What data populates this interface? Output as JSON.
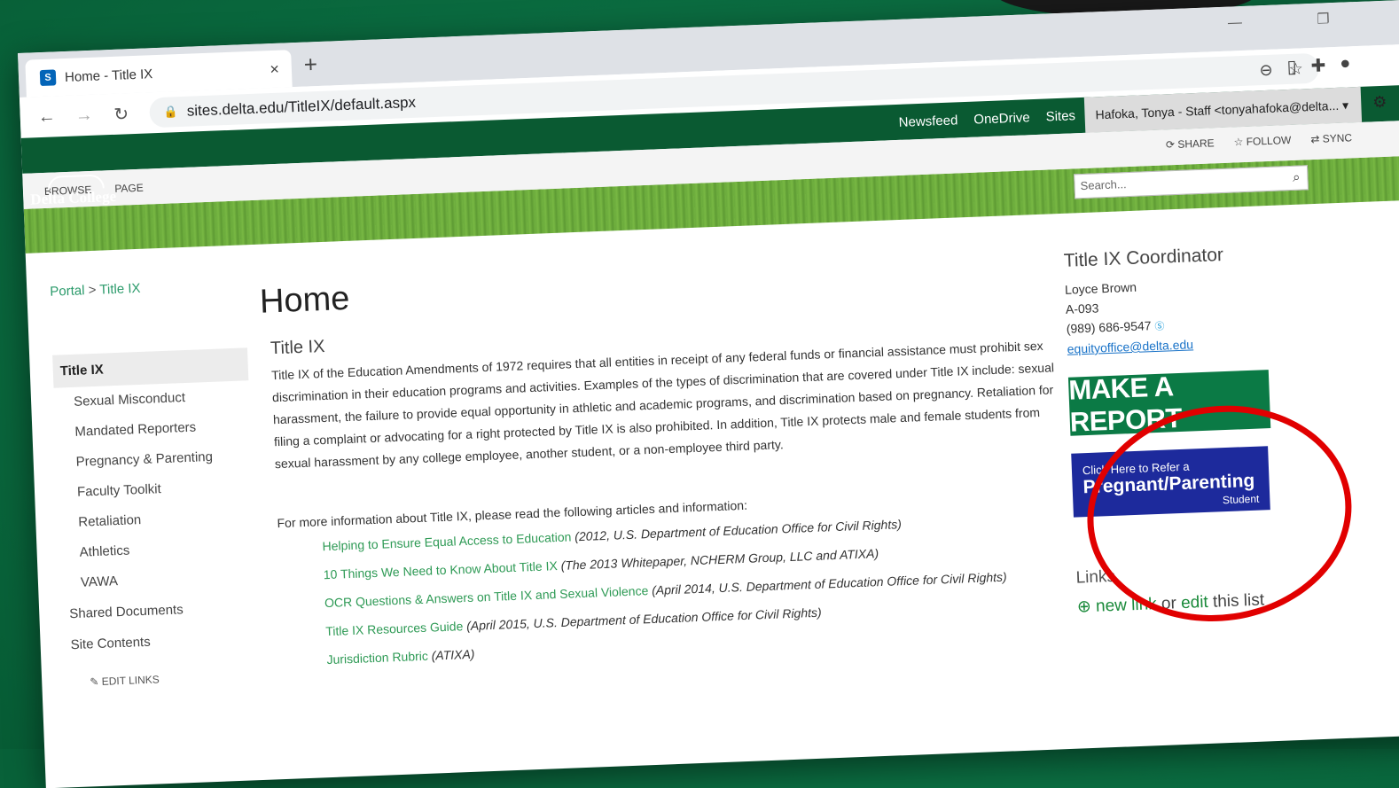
{
  "browser": {
    "tab_title": "Home - Title IX",
    "tab_favicon": "S",
    "close_glyph": "×",
    "new_tab_glyph": "+",
    "url": "sites.delta.edu/TitleIX/default.aspx",
    "window_controls": "— ❐"
  },
  "suite_bar": {
    "links": [
      "Newsfeed",
      "OneDrive",
      "Sites"
    ],
    "user": "Hafoka, Tonya - Staff <tonyahafoka@delta... ▾"
  },
  "site": {
    "logo_text": "Delta College"
  },
  "ribbon": {
    "tabs": [
      "BROWSE",
      "PAGE"
    ],
    "share": "SHARE",
    "follow": "FOLLOW",
    "sync": "SYNC"
  },
  "search": {
    "placeholder": "Search..."
  },
  "breadcrumb": {
    "root": "Portal",
    "separator": ">",
    "current": "Title IX"
  },
  "left_nav": {
    "selected": "Title IX",
    "items": [
      "Sexual Misconduct",
      "Mandated Reporters",
      "Pregnancy & Parenting",
      "Faculty Toolkit",
      "Retaliation",
      "Athletics",
      "VAWA"
    ],
    "roots": [
      "Shared Documents",
      "Site Contents"
    ],
    "edit_links": "EDIT LINKS"
  },
  "main": {
    "page_title": "Home",
    "section_title": "Title IX",
    "paragraph": "Title IX of the Education Amendments of 1972 requires that all entities in receipt of any federal funds or financial assistance must prohibit sex discrimination in their education programs and activities. Examples of the types of discrimination that are covered under Title IX include:  sexual harassment, the failure to provide equal opportunity in athletic and academic programs, and discrimination based on pregnancy. Retaliation for filing a complaint or advocating for a right protected by Title IX is also prohibited.   In addition, Title IX protects male and female students from sexual harassment by any college employee, another student, or a non-employee third party.",
    "intro": "For more information about Title IX, please read the following articles and information:",
    "resources": [
      {
        "link": "Helping to Ensure Equal Access to Education",
        "note": "(2012, U.S. Department of Education Office for Civil Rights)"
      },
      {
        "link": "10 Things We Need to Know About Title IX",
        "note": "(The 2013 Whitepaper, NCHERM Group, LLC and ATIXA)"
      },
      {
        "link": "OCR Questions & Answers on Title IX and Sexual Violence",
        "note": "(April 2014, U.S. Department of Education Office for Civil Rights)"
      },
      {
        "link": "Title IX Resources Guide",
        "note": "(April 2015, U.S. Department of Education Office for Civil Rights)"
      },
      {
        "link": "Jurisdiction Rubric",
        "note": "(ATIXA)"
      }
    ]
  },
  "coordinator": {
    "heading": "Title IX Coordinator",
    "name": "Loyce Brown",
    "office": "A-093",
    "phone": "(989) 686-9547",
    "email": "equityoffice@delta.edu"
  },
  "buttons": {
    "make_report": "MAKE A REPORT",
    "refer_top": "Click Here to Refer a",
    "refer_main": "Pregnant/Parenting",
    "refer_bottom": "Student"
  },
  "links_section": {
    "heading": "Links",
    "new_link": "new link",
    "or": "or",
    "edit": "edit",
    "this_list": "this list"
  },
  "colors": {
    "brand_green": "#0a5a32",
    "report_green": "#0b7a45",
    "refer_blue": "#1d2a9c",
    "highlight_red": "#e10000"
  }
}
